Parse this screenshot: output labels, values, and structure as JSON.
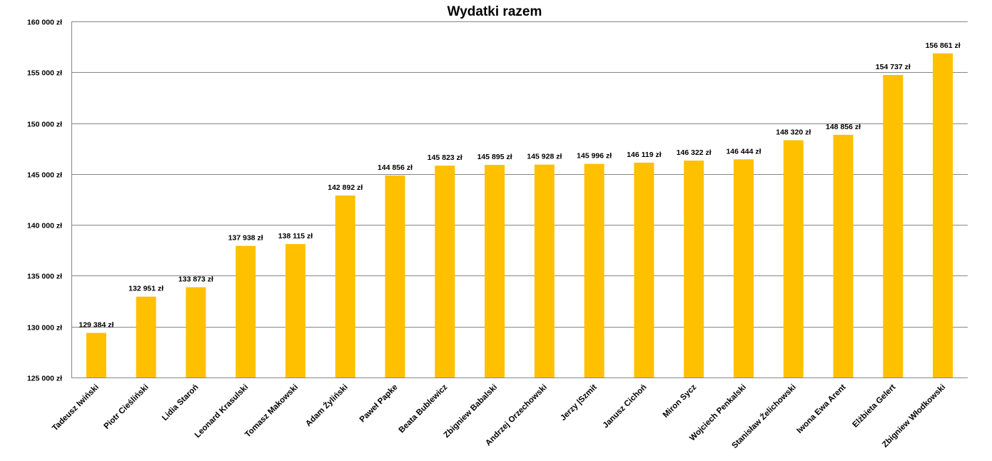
{
  "chart_data": {
    "type": "bar",
    "title": "Wydatki razem",
    "xlabel": "",
    "ylabel": "",
    "ylim": [
      125000,
      160000
    ],
    "ytick_step": 5000,
    "ytick_labels": [
      "125 000 zł",
      "130 000 zł",
      "135 000 zł",
      "140 000 zł",
      "145 000 zł",
      "150 000 zł",
      "155 000 zł",
      "160 000 zł"
    ],
    "grid": true,
    "legend": "none",
    "bar_color": "#FFC000",
    "grid_color": "#868686",
    "categories": [
      "Tadeusz Iwiński",
      "Piotr Cieśliński",
      "Lidia Staroń",
      "Leonard Krasulski",
      "Tomasz Makowski",
      "Adam Żyliński",
      "Paweł Papke",
      "Beata Bublewicz",
      "Zbigniew Babalski",
      "Andrzej Orzechowski",
      "Jerzy |Szmit",
      "Janusz Cichoń",
      "Miron Sycz",
      "Wojciech Penkalski",
      "Stanisław Żelichowski",
      "Iwona Ewa Arent",
      "Elżbieta Gelert",
      "Zbigniew Włodkowski"
    ],
    "values": [
      129384,
      132951,
      133873,
      137938,
      138115,
      142892,
      144856,
      145823,
      145895,
      145928,
      145996,
      146119,
      146322,
      146444,
      148320,
      148856,
      154737,
      156861
    ],
    "data_labels": [
      "129 384 zł",
      "132 951 zł",
      "133 873 zł",
      "137 938 zł",
      "138 115 zł",
      "142 892 zł",
      "144 856 zł",
      "145 823 zł",
      "145 895 zł",
      "145 928 zł",
      "145 996 zł",
      "146 119 zł",
      "146 322 zł",
      "146 444 zł",
      "148 320 zł",
      "148 856 zł",
      "154 737 zł",
      "156 861 zł"
    ]
  }
}
